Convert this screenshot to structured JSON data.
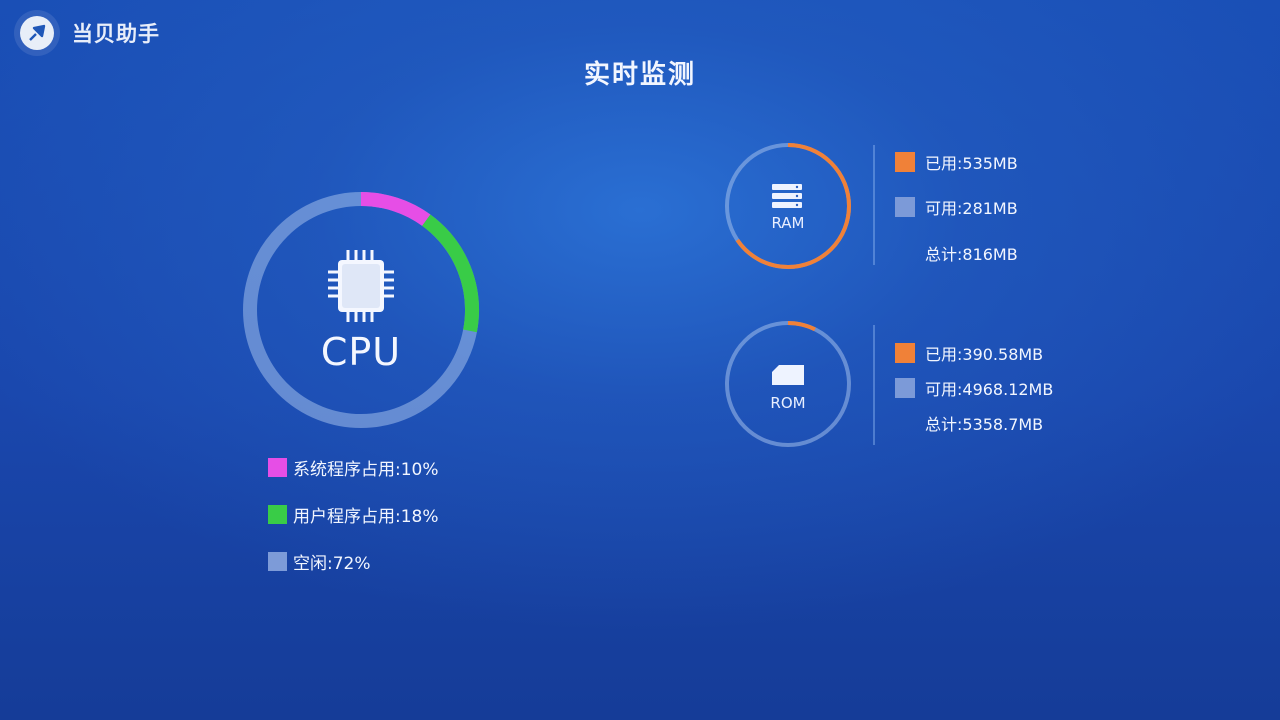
{
  "app": {
    "name": "当贝助手",
    "logo_icon": "rocket-icon"
  },
  "page": {
    "title": "实时监测"
  },
  "colors": {
    "system": "#e64ee6",
    "user": "#39cc47",
    "idle": "#7d9bd8",
    "used": "#f08138",
    "available": "#7c9ad8"
  },
  "cpu": {
    "label": "CPU",
    "system_percent": 10,
    "user_percent": 18,
    "idle_percent": 72,
    "legend": [
      {
        "key": "system",
        "text": "系统程序占用:10%"
      },
      {
        "key": "user",
        "text": "用户程序占用:18%"
      },
      {
        "key": "idle",
        "text": "空闲:72%"
      }
    ]
  },
  "ram": {
    "label": "RAM",
    "used_mb": 535,
    "total_mb": 816,
    "used_text": "已用:535MB",
    "available_text": "可用:281MB",
    "total_text": "总计:816MB"
  },
  "rom": {
    "label": "ROM",
    "used_mb": 390.58,
    "total_mb": 5358.7,
    "used_text": "已用:390.58MB",
    "available_text": "可用:4968.12MB",
    "total_text": "总计:5358.7MB"
  }
}
